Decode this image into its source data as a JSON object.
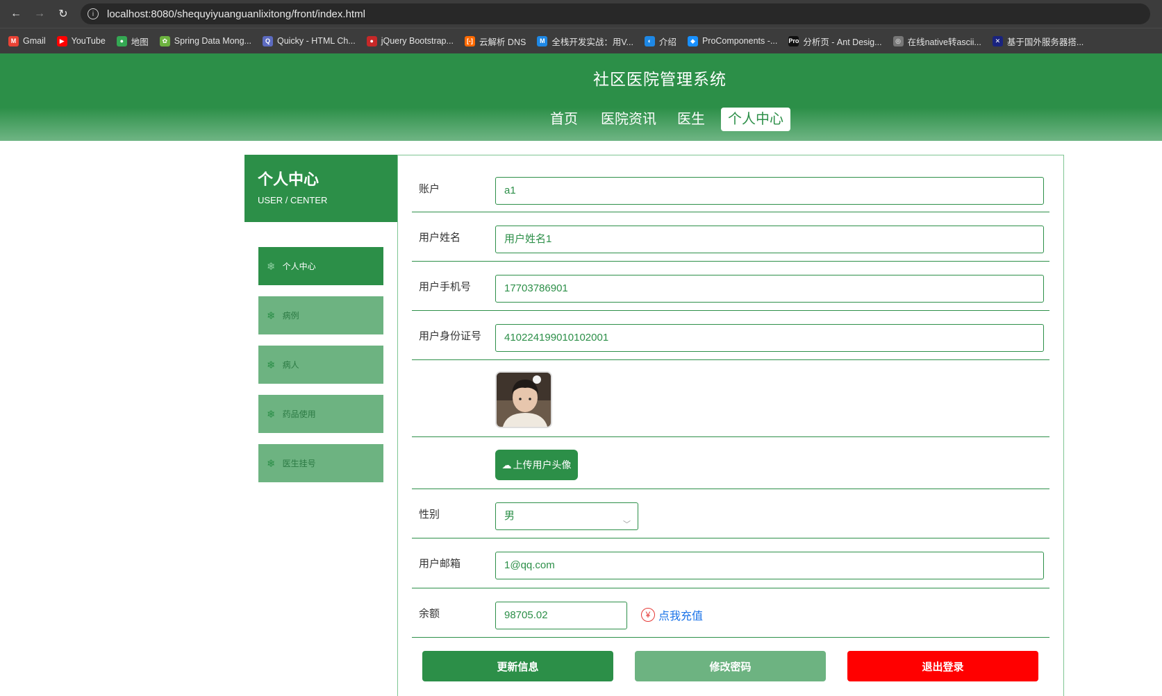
{
  "browser": {
    "url": "localhost:8080/shequyiyuanguanlixitong/front/index.html",
    "bookmarks": [
      {
        "label": "Gmail",
        "icon": "gmail-icon",
        "color": "#ea4335",
        "glyph": "M"
      },
      {
        "label": "YouTube",
        "icon": "youtube-icon",
        "color": "#ff0000",
        "glyph": "▶"
      },
      {
        "label": "地图",
        "icon": "maps-icon",
        "color": "#34a853",
        "glyph": "●"
      },
      {
        "label": "Spring Data Mong...",
        "icon": "spring-icon",
        "color": "#6db33f",
        "glyph": "✿"
      },
      {
        "label": "Quicky - HTML Ch...",
        "icon": "quicky-icon",
        "color": "#5c6bc0",
        "glyph": "Q"
      },
      {
        "label": "jQuery Bootstrap...",
        "icon": "jquery-icon",
        "color": "#c62828",
        "glyph": "●"
      },
      {
        "label": "云解析 DNS",
        "icon": "aliyun-icon",
        "color": "#ff6a00",
        "glyph": "[-]"
      },
      {
        "label": "全栈开发实战：用V...",
        "icon": "medium-icon",
        "color": "#1e88e5",
        "glyph": "M"
      },
      {
        "label": "介绍",
        "icon": "globe-half-icon",
        "color": "#1e88e5",
        "glyph": "◐"
      },
      {
        "label": "ProComponents -...",
        "icon": "antd-icon",
        "color": "#1890ff",
        "glyph": "◆"
      },
      {
        "label": "分析页 - Ant Desig...",
        "icon": "pro-icon",
        "color": "#111111",
        "glyph": "Pro"
      },
      {
        "label": "在线native转ascii...",
        "icon": "web-icon",
        "color": "#777777",
        "glyph": "◎"
      },
      {
        "label": "基于国外服务器搭...",
        "icon": "flag-icon",
        "color": "#1a237e",
        "glyph": "✕"
      }
    ]
  },
  "header": {
    "title": "社区医院管理系统",
    "nav": [
      {
        "label": "首页",
        "active": false
      },
      {
        "label": "医院资讯",
        "active": false
      },
      {
        "label": "医生",
        "active": false
      },
      {
        "label": "个人中心",
        "active": true
      }
    ]
  },
  "sidebar": {
    "title": "个人中心",
    "subtitle": "USER / CENTER",
    "items": [
      {
        "label": "个人中心",
        "active": true
      },
      {
        "label": "病例",
        "active": false
      },
      {
        "label": "病人",
        "active": false
      },
      {
        "label": "药品使用",
        "active": false
      },
      {
        "label": "医生挂号",
        "active": false
      }
    ]
  },
  "form": {
    "account_label": "账户",
    "account_value": "a1",
    "name_label": "用户姓名",
    "name_value": "用户姓名1",
    "phone_label": "用户手机号",
    "phone_value": "17703786901",
    "idcard_label": "用户身份证号",
    "idcard_value": "410224199010102001",
    "upload_label": "上传用户头像",
    "gender_label": "性别",
    "gender_value": "男",
    "email_label": "用户邮箱",
    "email_value": "1@qq.com",
    "balance_label": "余额",
    "balance_value": "98705.02",
    "recharge_label": "点我充值"
  },
  "actions": {
    "update": "更新信息",
    "change_password": "修改密码",
    "logout": "退出登录"
  },
  "colors": {
    "brand": "#2c8f48",
    "brand_light": "#6db381",
    "danger": "#ff0000",
    "link": "#1a73e8"
  }
}
